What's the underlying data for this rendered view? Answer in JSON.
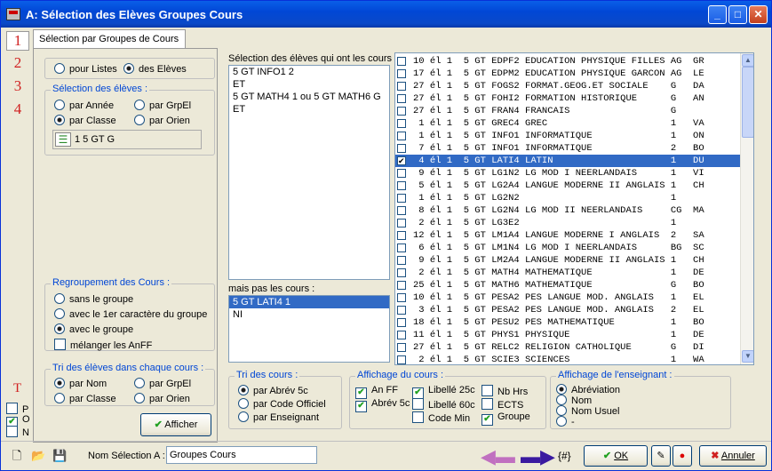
{
  "window": {
    "title": "A: Sélection des Elèves Groupes Cours"
  },
  "nums": [
    "1",
    "2",
    "3",
    "4"
  ],
  "tab_label": "Sélection par Groupes de Cours",
  "mode": {
    "listes": "pour Listes",
    "eleves": "des Elèves"
  },
  "selection_eleves": {
    "title": "Sélection des élèves :",
    "par_annee": "par Année",
    "par_grpel": "par GrpEl",
    "par_classe": "par Classe",
    "par_orien": "par Orien",
    "classe_value": "1 5 GT G"
  },
  "regroupement": {
    "title": "Regroupement des Cours :",
    "sans": "sans le groupe",
    "avec_1er": "avec le 1er caractère du groupe",
    "avec": "avec le groupe",
    "melanger": "mélanger les AnFF"
  },
  "tri_eleves": {
    "title": "Tri des élèves dans chaque cours :",
    "par_nom": "par Nom",
    "par_grpel": "par GrpEl",
    "par_classe": "par Classe",
    "par_orien": "par Orien"
  },
  "afficher_label": "Afficher",
  "T_label": "T",
  "pon": [
    "P",
    "O",
    "N"
  ],
  "cours_label": "Sélection des élèves qui ont les cours :",
  "cours_lines": [
    "5 GT INFO1 2",
    "ET",
    "5 GT MATH4 1  ou 5 GT MATH6 G",
    "ET"
  ],
  "mais_label": "mais pas les cours :",
  "mais_lines": [
    "5 GT LATI4 1",
    "NI"
  ],
  "grid_rows": [
    "10 él 1  5 GT EDPF2 EDUCATION PHYSIQUE FILLES AG  GR",
    "17 él 1  5 GT EDPM2 EDUCATION PHYSIQUE GARCON AG  LE",
    "27 él 1  5 GT FOGS2 FORMAT.GEOG.ET SOCIALE    G   DA",
    "27 él 1  5 GT FOHI2 FORMATION HISTORIQUE      G   AN",
    "27 él 1  5 GT FRAN4 FRANCAIS                  G",
    " 1 él 1  5 GT GREC4 GREC                      1   VA",
    " 1 él 1  5 GT INFO1 INFORMATIQUE              1   ON",
    " 7 él 1  5 GT INFO1 INFORMATIQUE              2   BO",
    " 4 él 1  5 GT LATI4 LATIN                     1   DU",
    " 9 él 1  5 GT LG1N2 LG MOD I NEERLANDAIS      1   VI",
    " 5 él 1  5 GT LG2A4 LANGUE MODERNE II ANGLAIS 1   CH",
    " 1 él 1  5 GT LG2N2                           1",
    " 8 él 1  5 GT LG2N4 LG MOD II NEERLANDAIS     CG  MA",
    " 2 él 1  5 GT LG3E2                           1",
    "12 él 1  5 GT LM1A4 LANGUE MODERNE I ANGLAIS  2   SA",
    " 6 él 1  5 GT LM1N4 LG MOD I NEERLANDAIS      BG  SC",
    " 9 él 1  5 GT LM2A4 LANGUE MODERNE II ANGLAIS 1   CH",
    " 2 él 1  5 GT MATH4 MATHEMATIQUE              1   DE",
    "25 él 1  5 GT MATH6 MATHEMATIQUE              G   BO",
    "10 él 1  5 GT PESA2 PES LANGUE MOD. ANGLAIS   1   EL",
    " 3 él 1  5 GT PESA2 PES LANGUE MOD. ANGLAIS   2   EL",
    "18 él 1  5 GT PESU2 PES MATHEMATIQUE          1   BO",
    "11 él 1  5 GT PHYS1 PHYSIQUE                  1   DE",
    "27 él 1  5 GT RELC2 RELIGION CATHOLIQUE       G   DI",
    " 2 él 1  5 GT SCIE3 SCIENCES                  1   WA"
  ],
  "grid_checked_index": 8,
  "tri_cours": {
    "title": "Tri des cours :",
    "abrev": "par Abrév 5c",
    "code": "par Code Officiel",
    "ens": "par Enseignant"
  },
  "affichage_cours": {
    "title": "Affichage du cours :",
    "anff": "An FF",
    "abrev5c": "Abrév 5c",
    "lib25": "Libellé 25c",
    "lib60": "Libellé 60c",
    "codemin": "Code Min",
    "nbhrs": "Nb Hrs",
    "ects": "ECTS",
    "groupe": "Groupe"
  },
  "affichage_ens": {
    "title": "Affichage de l'enseignant :",
    "abrev": "Abréviation",
    "nom": "Nom",
    "nomusuel": "Nom Usuel",
    "tiret": "-"
  },
  "bottom": {
    "nom_label": "Nom Sélection A :",
    "nom_value": "Groupes Cours",
    "hash": "{#}",
    "ok": "OK",
    "annuler": "Annuler"
  }
}
